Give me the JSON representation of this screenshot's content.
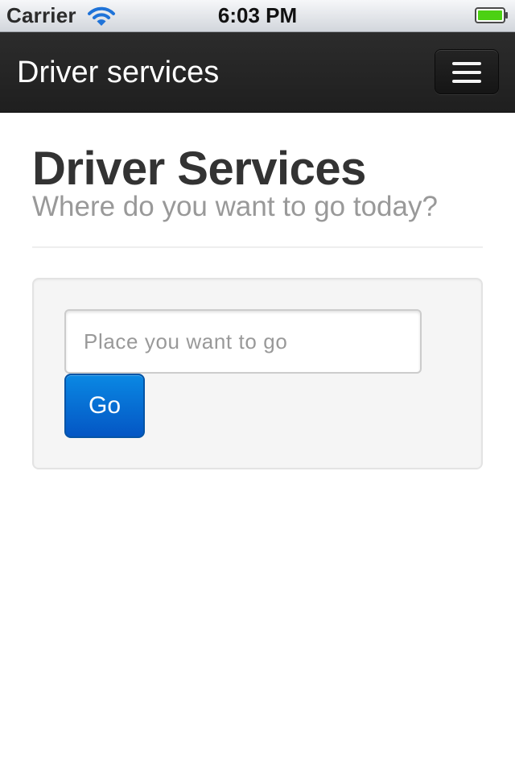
{
  "status_bar": {
    "carrier": "Carrier",
    "time": "6:03 PM",
    "wifi_icon": "wifi-icon",
    "battery_icon": "battery-icon",
    "battery_color": "#4cd113"
  },
  "navbar": {
    "brand": "Driver services",
    "menu_icon": "hamburger-menu-icon"
  },
  "header": {
    "title": "Driver Services",
    "subtitle": "Where do you want to go today?"
  },
  "form": {
    "destination_placeholder": "Place you want to go",
    "destination_value": "",
    "go_label": "Go"
  },
  "colors": {
    "navbar_bg": "#222222",
    "primary_button": "#0a6fd6",
    "title_text": "#333333",
    "subtitle_text": "#999999",
    "well_bg": "#f5f5f5"
  }
}
